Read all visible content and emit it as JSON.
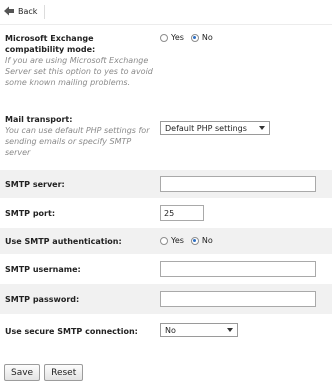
{
  "nav": {
    "back_label": "Back"
  },
  "exchange": {
    "label": "Microsoft Exchange compatibility mode:",
    "desc": "If you are using Microsoft Exchange Server set this option to yes to avoid some known mailing problems.",
    "yes": "Yes",
    "no": "No",
    "selected": "No"
  },
  "transport": {
    "label": "Mail transport:",
    "desc": "You can use default PHP settings for sending emails or specify SMTP server",
    "value": "Default PHP settings"
  },
  "smtp_server": {
    "label": "SMTP server:",
    "value": ""
  },
  "smtp_port": {
    "label": "SMTP port:",
    "value": "25"
  },
  "smtp_auth": {
    "label": "Use SMTP authentication:",
    "yes": "Yes",
    "no": "No",
    "selected": "No"
  },
  "smtp_username": {
    "label": "SMTP username:",
    "value": ""
  },
  "smtp_password": {
    "label": "SMTP password:",
    "value": ""
  },
  "secure": {
    "label": "Use secure SMTP connection:",
    "value": "No"
  },
  "actions": {
    "save": "Save",
    "reset": "Reset"
  },
  "colors": {
    "row_shade": "#f1f1f1",
    "radio_accent": "#2d6fc4"
  }
}
